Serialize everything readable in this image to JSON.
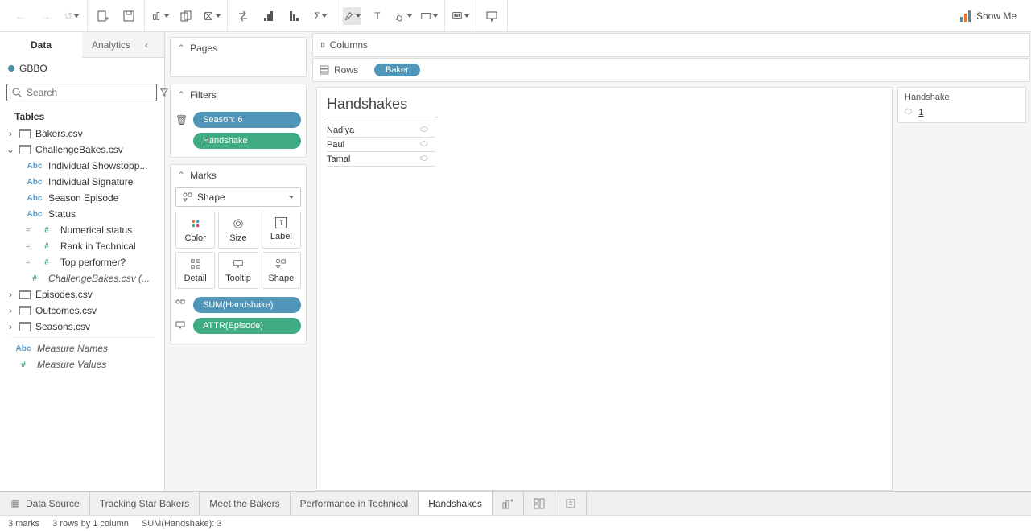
{
  "toolbar": {
    "showme_label": "Show Me"
  },
  "sidebar": {
    "tabs": {
      "data": "Data",
      "analytics": "Analytics"
    },
    "connection": "GBBO",
    "search_placeholder": "Search",
    "tables_label": "Tables",
    "tables": [
      {
        "name": "Bakers.csv",
        "expanded": false
      },
      {
        "name": "ChallengeBakes.csv",
        "expanded": true,
        "fields": [
          {
            "type": "Abc",
            "name": "Individual Showstopp..."
          },
          {
            "type": "Abc",
            "name": "Individual Signature"
          },
          {
            "type": "Abc",
            "name": "Season Episode"
          },
          {
            "type": "Abc",
            "name": "Status"
          },
          {
            "type": "#",
            "name": "Numerical status",
            "calc": true
          },
          {
            "type": "#",
            "name": "Rank in Technical",
            "calc": true
          },
          {
            "type": "#",
            "name": "Top performer?",
            "calc": true
          },
          {
            "type": "#",
            "name": "ChallengeBakes.csv (...",
            "italic": true
          }
        ]
      },
      {
        "name": "Episodes.csv",
        "expanded": false
      },
      {
        "name": "Outcomes.csv",
        "expanded": false
      },
      {
        "name": "Seasons.csv",
        "expanded": false
      }
    ],
    "generated": [
      {
        "type": "Abc",
        "name": "Measure Names"
      },
      {
        "type": "#",
        "name": "Measure Values"
      }
    ]
  },
  "shelves": {
    "pages": "Pages",
    "filters": "Filters",
    "filter_items": [
      {
        "label": "Season: 6",
        "class": "blue"
      },
      {
        "label": "Handshake",
        "class": "green"
      }
    ],
    "marks": "Marks",
    "mark_type": "Shape",
    "mark_buttons": [
      "Color",
      "Size",
      "Label",
      "Detail",
      "Tooltip",
      "Shape"
    ],
    "mark_pills": [
      {
        "label": "SUM(Handshake)",
        "class": "blue",
        "icon": "shape"
      },
      {
        "label": "ATTR(Episode)",
        "class": "green",
        "icon": "tooltip"
      }
    ]
  },
  "colrows": {
    "columns_label": "Columns",
    "rows_label": "Rows",
    "rows_pills": [
      "Baker"
    ]
  },
  "viz": {
    "title": "Handshakes",
    "rows": [
      "Nadiya",
      "Paul",
      "Tamal"
    ]
  },
  "legend": {
    "title": "Handshake",
    "value": "1"
  },
  "bottom_tabs": {
    "data_source": "Data Source",
    "sheets": [
      "Tracking Star Bakers",
      "Meet the Bakers",
      "Performance in Technical",
      "Handshakes"
    ],
    "active": "Handshakes"
  },
  "status": {
    "marks": "3 marks",
    "dims": "3 rows by 1 column",
    "sum": "SUM(Handshake): 3"
  }
}
